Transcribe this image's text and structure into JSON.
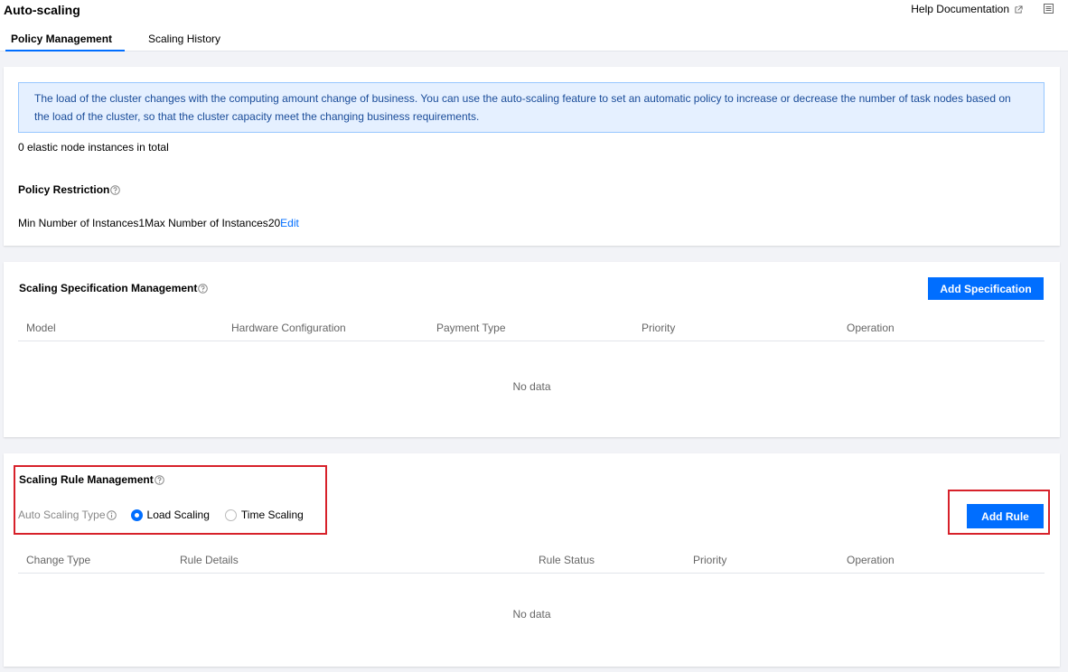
{
  "header": {
    "title": "Auto-scaling",
    "help_link": "Help Documentation"
  },
  "tabs": [
    {
      "label": "Policy Management",
      "active": true
    },
    {
      "label": "Scaling History",
      "active": false
    }
  ],
  "overview": {
    "notice": "The load of the cluster changes with the computing amount change of business. You can use the auto-scaling feature to set an automatic policy to increase or decrease the number of task nodes based on the load of the cluster, so that the cluster capacity meet the changing business requirements.",
    "total": "0 elastic node instances in total",
    "restriction_title": "Policy Restriction",
    "min_label": "Min Number of Instances",
    "min_value": "1",
    "max_label": "Max Number of Instances",
    "max_value": "20",
    "edit_label": "Edit"
  },
  "spec": {
    "title": "Scaling Specification Management",
    "add_button": "Add Specification",
    "columns": [
      "Model",
      "Hardware Configuration",
      "Payment Type",
      "Priority",
      "Operation"
    ],
    "empty": "No data"
  },
  "rule": {
    "title": "Scaling Rule Management",
    "type_label": "Auto Scaling Type",
    "options": [
      {
        "label": "Load Scaling",
        "selected": true
      },
      {
        "label": "Time Scaling",
        "selected": false
      }
    ],
    "add_button": "Add Rule",
    "columns": [
      "Change Type",
      "Rule Details",
      "Rule Status",
      "Priority",
      "Operation"
    ],
    "empty": "No data"
  },
  "colors": {
    "accent": "#006eff",
    "highlight": "#d7212a",
    "notice_bg": "#e5f0ff"
  }
}
